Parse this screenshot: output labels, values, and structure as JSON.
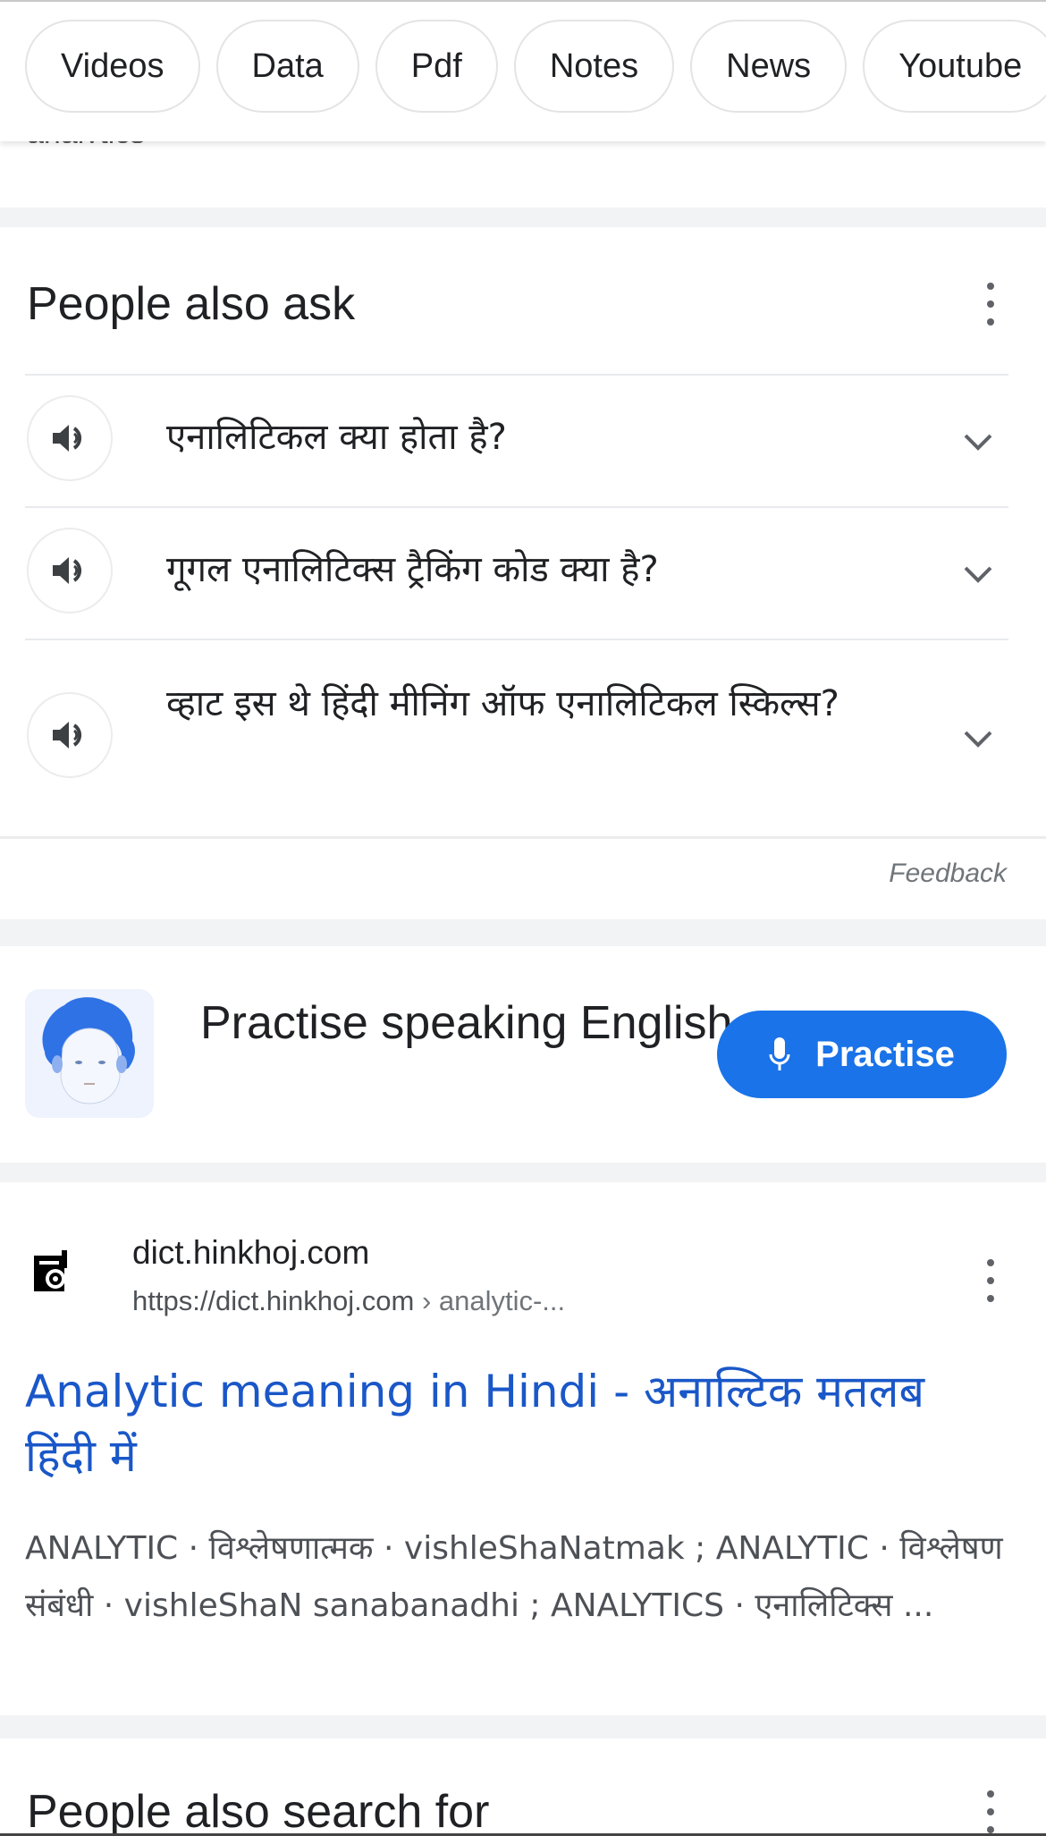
{
  "chips": [
    "Videos",
    "Data",
    "Pdf",
    "Notes",
    "News",
    "Youtube"
  ],
  "partial_text_under_header": "analytics",
  "people_also_ask": {
    "title": "People also ask",
    "questions": [
      {
        "text": "एनालिटिकल क्या होता है?",
        "speaker_icon": "speaker-icon",
        "chevron_icon": "chevron-down-icon"
      },
      {
        "text": "गूगल एनालिटिक्स ट्रैकिंग कोड क्या है?",
        "speaker_icon": "speaker-icon",
        "chevron_icon": "chevron-down-icon"
      },
      {
        "text": "व्हाट इस थे हिंदी मीनिंग ऑफ एनालिटिकल स्किल्स?",
        "speaker_icon": "speaker-icon",
        "chevron_icon": "chevron-down-icon"
      }
    ],
    "feedback_label": "Feedback"
  },
  "practise_card": {
    "text": "Practise speaking English",
    "button_label": "Practise",
    "button_icon": "microphone-icon",
    "accent_color": "#1a73e8"
  },
  "result": {
    "site_name": "dict.hinkhoj.com",
    "url_base": "https://dict.hinkhoj.com",
    "url_crumb": " › analytic-...",
    "title": "Analytic meaning in Hindi - अनाल्टिक मतलब हिंदी में",
    "snippet": "ANALYTIC · विश्लेषणात्मक · vishleShaNatmak ; ANALYTIC · विश्लेषण संबंधी · vishleShaN sanabanadhi ; ANALYTICS · एनालिटिक्स ...",
    "title_color": "#1a57c8"
  },
  "people_also_search_for": {
    "title": "People also search for"
  }
}
